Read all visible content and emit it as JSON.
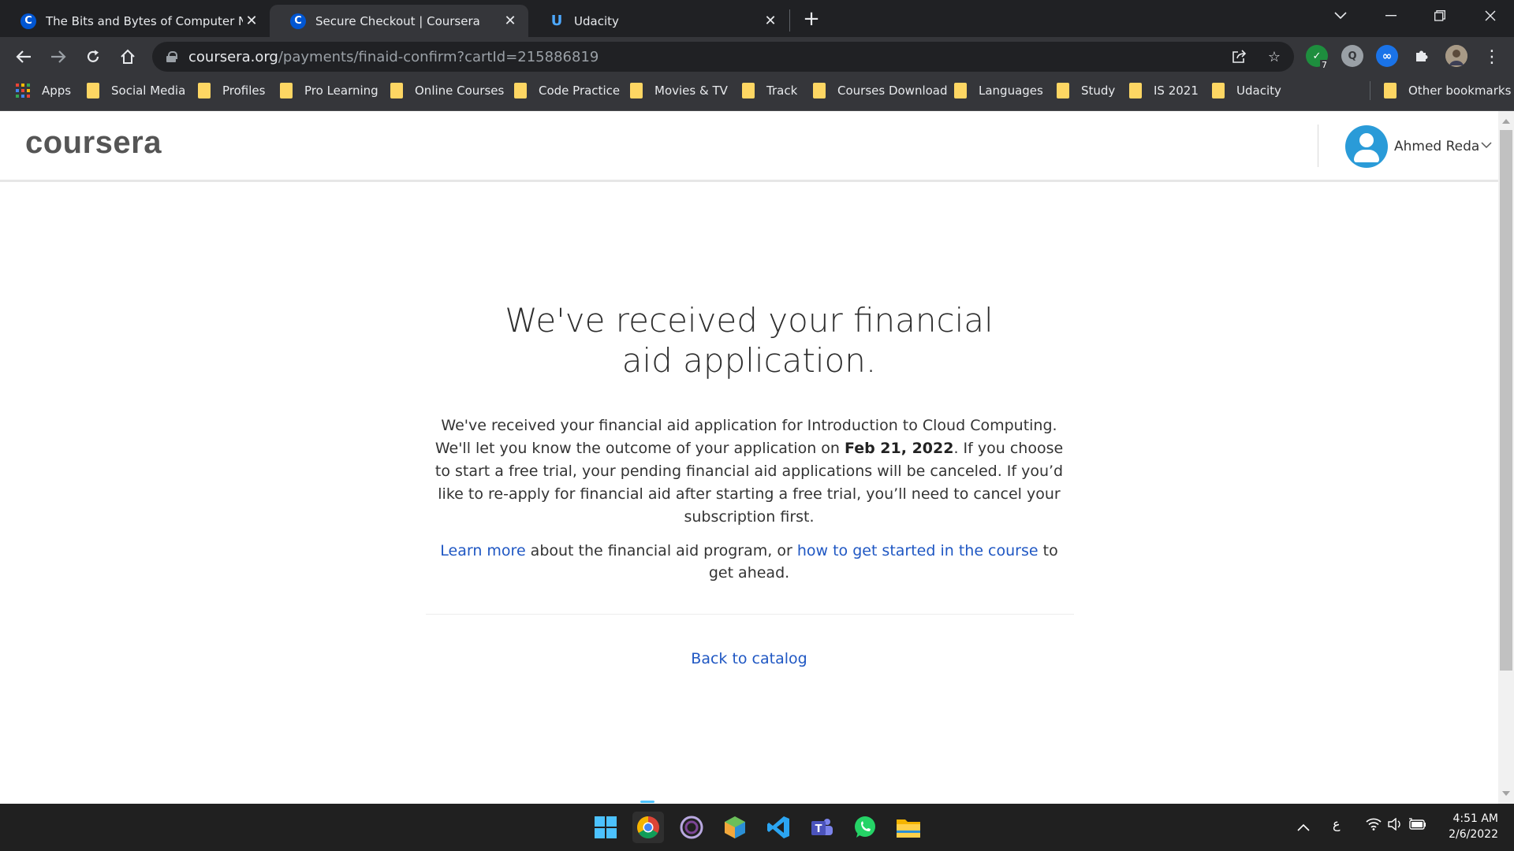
{
  "browser": {
    "tabs": [
      {
        "title": "The Bits and Bytes of Computer Net",
        "favicon": "C",
        "active": false
      },
      {
        "title": "Secure Checkout | Coursera",
        "favicon": "C",
        "active": true
      },
      {
        "title": "Udacity",
        "favicon": "U",
        "active": false
      }
    ],
    "url_host": "coursera.org",
    "url_path": "/payments/finaid-confirm?cartId=215886819",
    "extension_badge": "7",
    "bookmarks": [
      "Apps",
      "Social Media",
      "Profiles",
      "Pro Learning",
      "Online Courses",
      "Code Practice",
      "Movies & TV",
      "Track",
      "Courses Download",
      "Languages",
      "Study",
      "IS 2021",
      "Udacity"
    ],
    "other_bookmarks": "Other bookmarks"
  },
  "page": {
    "logo": "coursera",
    "username": "Ahmed Reda",
    "headline": "We've received your financial aid application.",
    "para_part1": "We've received your financial aid application for Introduction to Cloud Computing. We'll let you know the outcome of your application on ",
    "para_date": "Feb 21, 2022",
    "para_part2": ". If you choose to start a free trial, your pending financial aid applications will be canceled. If you’d like to re-apply for financial aid after starting a free trial, you’ll need to cancel your subscription first.",
    "learn_more": "Learn more",
    "about_text": " about the financial aid program, or ",
    "get_started_link": "how to get started in the course",
    "ahead_text": " to get ahead.",
    "back_link": "Back to catalog"
  },
  "taskbar": {
    "time": "4:51 AM",
    "date": "2/6/2022",
    "language": "ع"
  },
  "colors": {
    "link": "#1f57c3",
    "coursera_blue": "#0056d2",
    "folder": "#fdd663",
    "avatar": "#2a9bd8"
  }
}
